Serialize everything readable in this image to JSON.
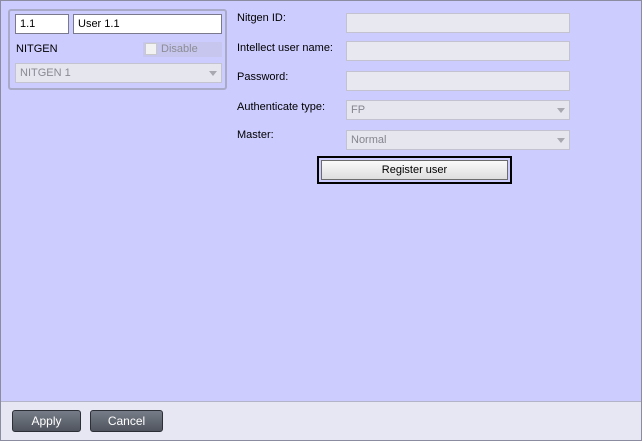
{
  "identity": {
    "number": "1.1",
    "name": "User 1.1",
    "module_label": "NITGEN",
    "disable_label": "Disable",
    "disable_checked": false,
    "device_selected": "NITGEN 1"
  },
  "form": {
    "nitgen_id_label": "Nitgen ID:",
    "nitgen_id_value": "",
    "intellect_user_label": "Intellect user name:",
    "intellect_user_value": "",
    "password_label": "Password:",
    "password_value": "",
    "auth_type_label": "Authenticate type:",
    "auth_type_value": "FP",
    "master_label": "Master:",
    "master_value": "Normal",
    "register_label": "Register user"
  },
  "footer": {
    "apply_label": "Apply",
    "cancel_label": "Cancel"
  },
  "colors": {
    "background": "#ccccff",
    "footer_background": "#e7e7f3",
    "button_dark": "#5b606a"
  }
}
